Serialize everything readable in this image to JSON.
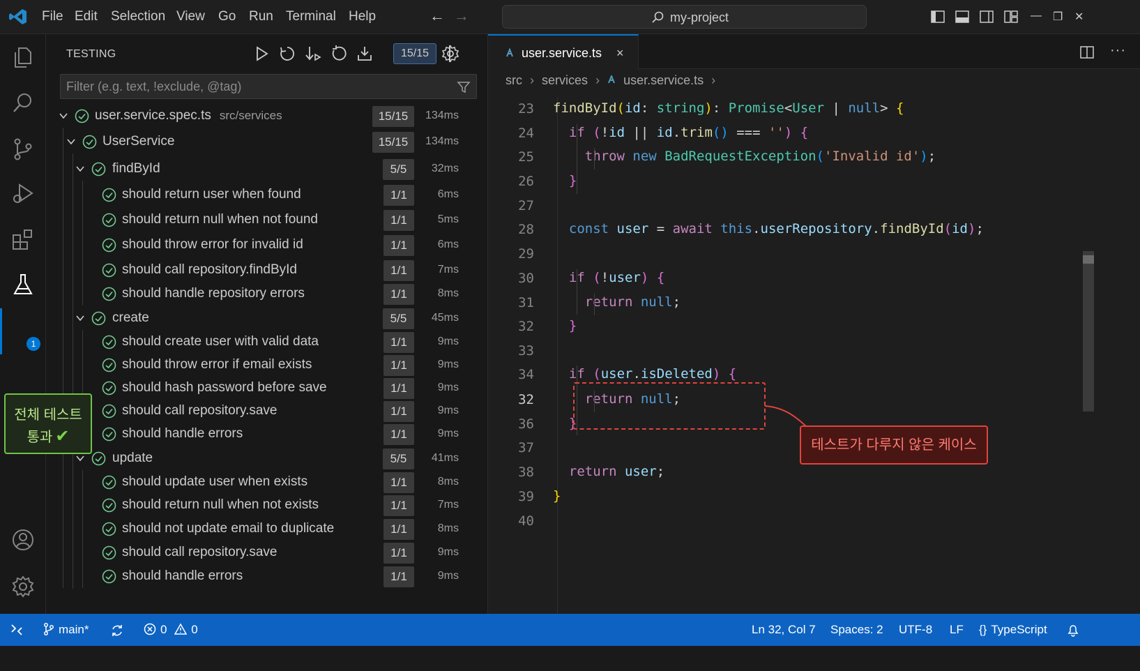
{
  "menu": [
    "File",
    "Edit",
    "Selection",
    "View",
    "Go",
    "Run",
    "Terminal",
    "Help"
  ],
  "command_center": {
    "text": "my-project"
  },
  "activity_badge": "1",
  "testing": {
    "title": "TESTING",
    "counter": "15/15",
    "filter_placeholder": "Filter (e.g. text, !exclude, @tag)",
    "file": {
      "name": "user.service.spec.ts",
      "path": "src/services",
      "badge": "15/15",
      "time": "134ms"
    },
    "suite": {
      "name": "UserService",
      "badge": "15/15",
      "time": "134ms"
    },
    "groups": [
      {
        "name": "findById",
        "badge": "5/5",
        "time": "32ms",
        "tests": [
          {
            "name": "should return user when found",
            "badge": "1/1",
            "time": "6ms"
          },
          {
            "name": "should return null when not found",
            "badge": "1/1",
            "time": "5ms"
          },
          {
            "name": "should throw error for invalid id",
            "badge": "1/1",
            "time": "6ms"
          },
          {
            "name": "should call repository.findById",
            "badge": "1/1",
            "time": "7ms"
          },
          {
            "name": "should handle repository errors",
            "badge": "1/1",
            "time": "8ms"
          }
        ]
      },
      {
        "name": "create",
        "badge": "5/5",
        "time": "45ms",
        "tests": [
          {
            "name": "should create user with valid data",
            "badge": "1/1",
            "time": "9ms"
          },
          {
            "name": "should throw error if email exists",
            "badge": "1/1",
            "time": "9ms"
          },
          {
            "name": "should hash password before save",
            "badge": "1/1",
            "time": "9ms"
          },
          {
            "name": "should call repository.save",
            "badge": "1/1",
            "time": "9ms"
          },
          {
            "name": "should handle errors",
            "badge": "1/1",
            "time": "9ms"
          }
        ]
      },
      {
        "name": "update",
        "badge": "5/5",
        "time": "41ms",
        "tests": [
          {
            "name": "should update user when exists",
            "badge": "1/1",
            "time": "8ms"
          },
          {
            "name": "should return null when not exists",
            "badge": "1/1",
            "time": "7ms"
          },
          {
            "name": "should not update email to duplicate",
            "badge": "1/1",
            "time": "8ms"
          },
          {
            "name": "should call repository.save",
            "badge": "1/1",
            "time": "9ms"
          },
          {
            "name": "should handle errors",
            "badge": "1/1",
            "time": "9ms"
          }
        ]
      }
    ]
  },
  "callouts": {
    "all_pass_line1": "전체 테스트",
    "all_pass_line2": "통과",
    "all_pass_check": "✔",
    "untested": "테스트가 다루지 않은 케이스"
  },
  "editor": {
    "tab": {
      "label": "user.service.ts",
      "close": "×"
    },
    "breadcrumb": [
      "src",
      "services",
      "user.service.ts"
    ],
    "lines": [
      {
        "n": "23",
        "html": "<span class=\"fn\">findById</span><span class=\"br1\">(</span><span class=\"vr\">id</span><span class=\"nm\">: </span><span class=\"ty\">string</span><span class=\"br1\">)</span><span class=\"nm\">: </span><span class=\"ty\">Promise</span><span class=\"nm\">&lt;</span><span class=\"ty\">User</span><span class=\"nm\"> | </span><span class=\"kw\">null</span><span class=\"nm\">&gt; </span><span class=\"br1\">{</span>"
      },
      {
        "n": "24",
        "html": "  <span class=\"ctl\">if</span><span class=\"nm\"> </span><span class=\"br2\">(</span><span class=\"nm\">!</span><span class=\"vr\">id</span><span class=\"nm\"> || </span><span class=\"vr\">id</span><span class=\"nm\">.</span><span class=\"fn\">trim</span><span class=\"br3\">()</span><span class=\"nm\"> === </span><span class=\"st\">''</span><span class=\"br2\">)</span><span class=\"nm\"> </span><span class=\"br2\">{</span>"
      },
      {
        "n": "25",
        "html": "    <span class=\"ctl\">throw</span><span class=\"nm\"> </span><span class=\"kw\">new</span><span class=\"nm\"> </span><span class=\"ty\">BadRequestException</span><span class=\"br3\">(</span><span class=\"st\">'Invalid id'</span><span class=\"br3\">)</span><span class=\"nm\">;</span>"
      },
      {
        "n": "26",
        "html": "  <span class=\"br2\">}</span>"
      },
      {
        "n": "27",
        "html": ""
      },
      {
        "n": "28",
        "html": "  <span class=\"kw\">const</span><span class=\"nm\"> </span><span class=\"vr\">user</span><span class=\"nm\"> = </span><span class=\"ctl\">await</span><span class=\"nm\"> </span><span class=\"kw\">this</span><span class=\"nm\">.</span><span class=\"vr\">userRepository</span><span class=\"nm\">.</span><span class=\"fn\">findById</span><span class=\"br2\">(</span><span class=\"vr\">id</span><span class=\"br2\">)</span><span class=\"nm\">;</span>"
      },
      {
        "n": "29",
        "html": ""
      },
      {
        "n": "30",
        "html": "  <span class=\"ctl\">if</span><span class=\"nm\"> </span><span class=\"br2\">(</span><span class=\"nm\">!</span><span class=\"vr\">user</span><span class=\"br2\">)</span><span class=\"nm\"> </span><span class=\"br2\">{</span>"
      },
      {
        "n": "31",
        "html": "    <span class=\"ctl\">return</span><span class=\"nm\"> </span><span class=\"kw\">null</span><span class=\"nm\">;</span>"
      },
      {
        "n": "32",
        "html": "  <span class=\"br2\">}</span>"
      },
      {
        "n": "33",
        "html": ""
      },
      {
        "n": "34",
        "html": "  <span class=\"ctl\">if</span><span class=\"nm\"> </span><span class=\"br2\">(</span><span class=\"vr\">user</span><span class=\"nm\">.</span><span class=\"vr\">isDeleted</span><span class=\"br2\">)</span><span class=\"nm\"> </span><span class=\"br2\">{</span>"
      },
      {
        "n": "32",
        "html": "    <span class=\"ctl\">return</span><span class=\"nm\"> </span><span class=\"kw\">null</span><span class=\"nm\">;</span>",
        "active": true
      },
      {
        "n": "36",
        "html": "  <span class=\"br2\">}</span>"
      },
      {
        "n": "37",
        "html": ""
      },
      {
        "n": "38",
        "html": "  <span class=\"ctl\">return</span><span class=\"nm\"> </span><span class=\"vr\">user</span><span class=\"nm\">;</span>"
      },
      {
        "n": "39",
        "html": "<span class=\"br1\">}</span>"
      },
      {
        "n": "40",
        "html": ""
      }
    ]
  },
  "statusbar": {
    "branch": "main*",
    "errors": "0",
    "warnings": "0",
    "position": "Ln 32, Col 7",
    "spaces": "Spaces: 2",
    "encoding": "UTF-8",
    "eol": "LF",
    "language": "TypeScript"
  },
  "colors": {
    "accent": "#0078d4",
    "status_bar": "#0e63c2",
    "pass_green": "#73c991",
    "callout_red": "#e0443e",
    "callout_green": "#6fc447"
  }
}
